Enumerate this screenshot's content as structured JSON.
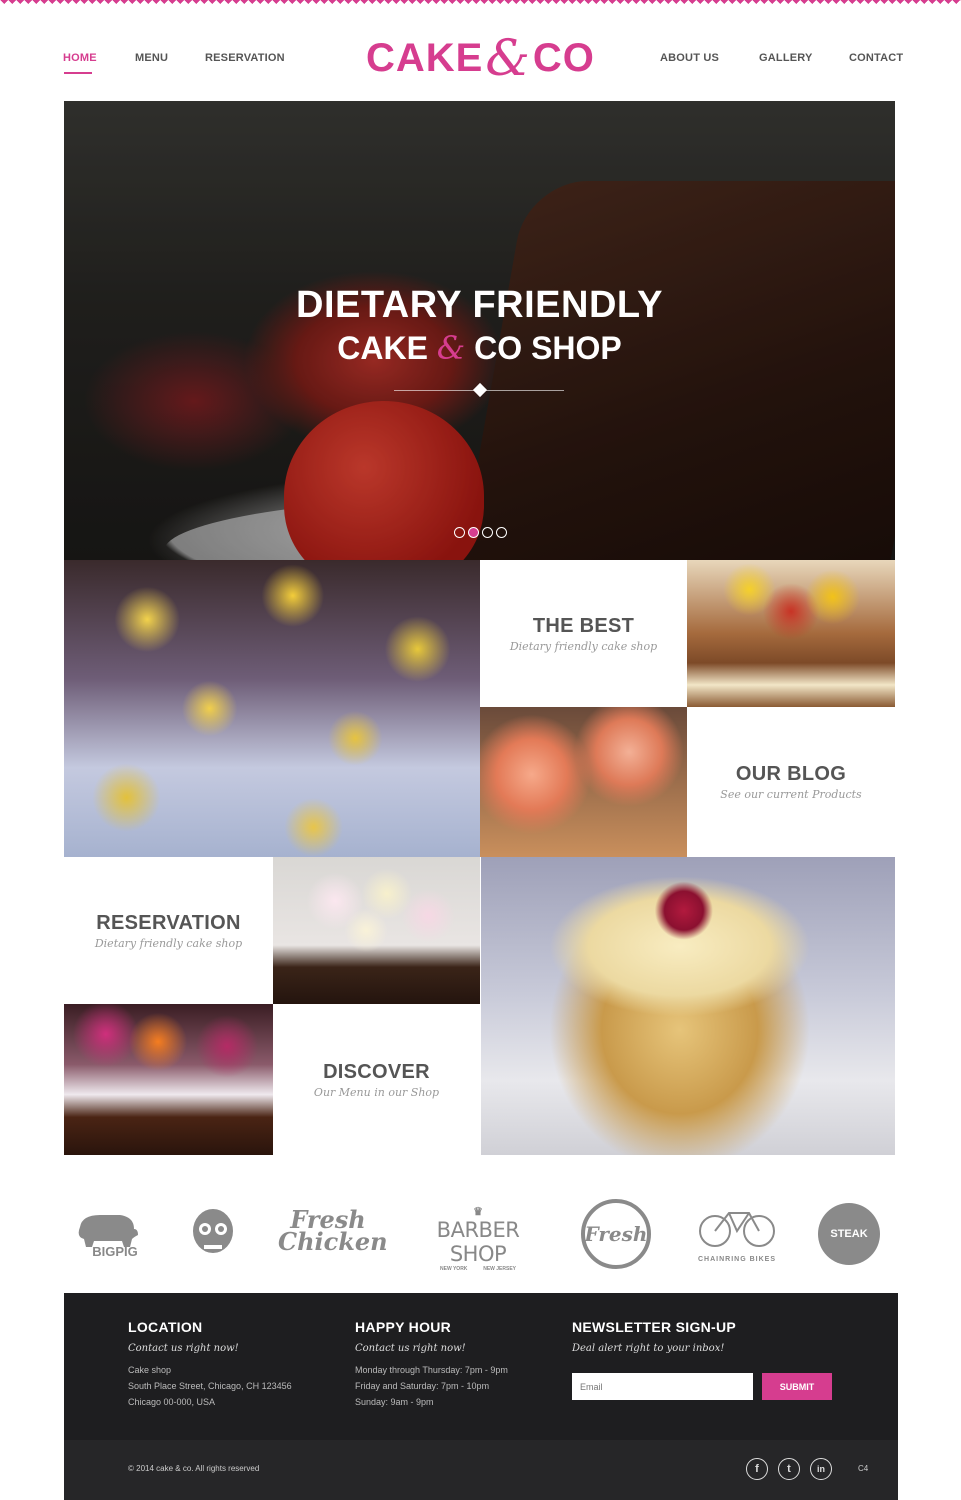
{
  "brand": {
    "logo_left": "CAKE",
    "logo_amp": "&",
    "logo_right": "CO",
    "accent": "#d63d8f"
  },
  "nav": {
    "left": [
      "HOME",
      "MENU",
      "RESERVATION"
    ],
    "right": [
      "ABOUT US",
      "GALLERY",
      "CONTACT"
    ],
    "active": "HOME"
  },
  "hero": {
    "line1": "DIETARY FRIENDLY",
    "line2_left": "CAKE",
    "line2_amp": "&",
    "line2_right": "CO SHOP",
    "slides": 4,
    "active_slide": 2
  },
  "tiles": {
    "best": {
      "title": "THE BEST",
      "subtitle": "Dietary friendly cake shop"
    },
    "blog": {
      "title": "OUR BLOG",
      "subtitle": "See our current Products"
    },
    "reservation": {
      "title": "RESERVATION",
      "subtitle": "Dietary friendly cake shop"
    },
    "discover": {
      "title": "DISCOVER",
      "subtitle": "Our Menu in our Shop"
    }
  },
  "partners": {
    "bigpig": "BIGPIG",
    "fresh_chicken": "Fresh Chicken",
    "barber": "BARBER SHOP",
    "barber_left": "NEW YORK",
    "barber_right": "NEW JERSEY",
    "fresh_badge": "Fresh",
    "bikes": "CHAINRING BIKES",
    "steak": "STEAK"
  },
  "footer": {
    "location": {
      "title": "LOCATION",
      "sub": "Contact us right now!",
      "lines": [
        "Cake shop",
        "South Place Street, Chicago, CH 123456",
        "Chicago 00-000, USA"
      ]
    },
    "happy": {
      "title": "HAPPY HOUR",
      "sub": "Contact us right now!",
      "lines": [
        "Monday through Thursday: 7pm - 9pm",
        "Friday and Saturday: 7pm - 10pm",
        "Sunday: 9am - 9pm"
      ]
    },
    "newsletter": {
      "title": "NEWSLETTER SIGN-UP",
      "sub": "Deal alert right to your inbox!",
      "placeholder": "Email",
      "button": "SUBMIT"
    },
    "copyright": "© 2014 cake & co. All rights reserved",
    "social": [
      "f",
      "t",
      "in"
    ],
    "credit": "C4"
  }
}
